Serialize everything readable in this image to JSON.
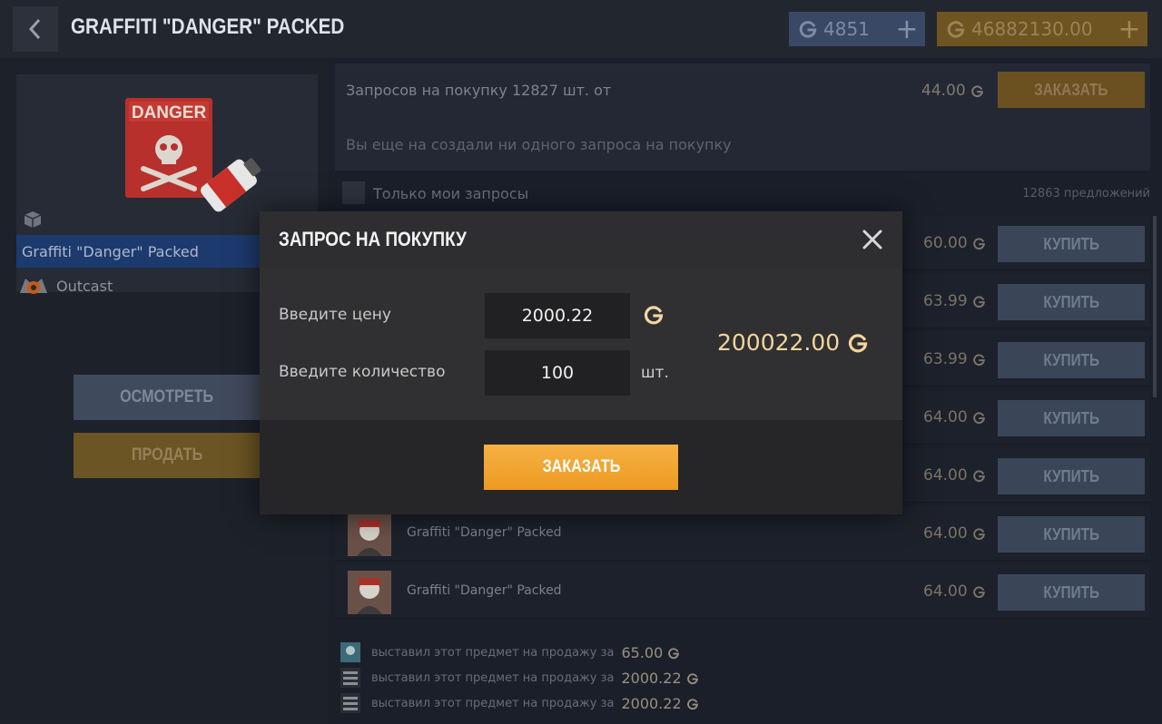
{
  "header": {
    "title": "GRAFFITI \"DANGER\" PACKED",
    "silver_balance": "4851",
    "gold_balance": "46882130.00",
    "plus_label": "+"
  },
  "item": {
    "image_text": "DANGER",
    "name": "Graffiti \"Danger\" Packed",
    "collection": "Outcast",
    "inspect_label": "ОСМОТРЕТЬ",
    "sell_label": "ПРОДАТЬ"
  },
  "requests": {
    "summary": "Запросов на покупку 12827 шт. от",
    "min_price": "44.00",
    "order_label": "ЗАКАЗАТЬ",
    "empty_text": "Вы еще на создали ни одного запроса на покупку",
    "filter_label": "Только мои запросы",
    "offers_count": "12863 предложений"
  },
  "offers": [
    {
      "name": "",
      "price": "60.00",
      "buy": "КУПИТЬ"
    },
    {
      "name": "",
      "price": "63.99",
      "buy": "КУПИТЬ"
    },
    {
      "name": "",
      "price": "63.99",
      "buy": "КУПИТЬ"
    },
    {
      "name": "",
      "price": "64.00",
      "buy": "КУПИТЬ"
    },
    {
      "name": "",
      "price": "64.00",
      "buy": "КУПИТЬ"
    },
    {
      "name": "Graffiti \"Danger\" Packed",
      "price": "64.00",
      "buy": "КУПИТЬ"
    },
    {
      "name": "Graffiti \"Danger\" Packed",
      "price": "64.00",
      "buy": "КУПИТЬ"
    }
  ],
  "history": [
    {
      "text": "выставил этот предмет на продажу за",
      "price": "65.00"
    },
    {
      "text": "выставил этот предмет на продажу за",
      "price": "2000.22"
    },
    {
      "text": "выставил этот предмет на продажу за",
      "price": "2000.22"
    }
  ],
  "modal": {
    "title": "ЗАПРОС НА ПОКУПКУ",
    "price_label": "Введите цену",
    "price_value": "2000.22",
    "qty_label": "Введите количество",
    "qty_value": "100",
    "qty_unit": "шт.",
    "total": "200022.00",
    "order_label": "ЗАКАЗАТЬ"
  },
  "colors": {
    "gold_accent": "#f0a02a",
    "total_text": "#f3d59b",
    "selected_row": "#1d3a6e"
  }
}
